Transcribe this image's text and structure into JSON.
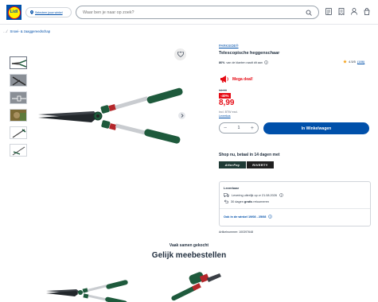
{
  "header": {
    "logo_text": "Lidl",
    "store_selector_label": "Selecteer jouw winkel",
    "search_placeholder": "Waar ben je naar op zoek?",
    "icons": [
      "my-list-icon",
      "receipt-icon",
      "account-icon",
      "cart-icon"
    ]
  },
  "breadcrumb": {
    "separator": "…/",
    "category": "Snoei- & zaaggereedschap"
  },
  "gallery": {
    "thumbnail_count": 6,
    "active_index": 0
  },
  "product": {
    "brand": "PARKSIDE®",
    "title": "Telescopische heggenschaar",
    "recommend_pct": "86%",
    "recommend_text": "van de klanten raadt dit aan",
    "rating": "4.5/5",
    "review_count": "(186)",
    "deal_label": "Mega deal!",
    "old_price": "14.99",
    "discount": "-40%",
    "price": "8,99",
    "vat_text": "Incl. BTW excl.",
    "delivery_cost_link": "Leverkos",
    "quantity": "1",
    "quantity_minus": "−",
    "quantity_plus": "+",
    "cart_button": "In Winkelwagen",
    "paylater_text": "Shop nu, betaal in 14 dagen met",
    "pay_logos": [
      "AfterPay",
      "RIVERTY"
    ],
    "availability": {
      "title": "Leverbaar",
      "delivery_text": "Levering uiterlijk op vr 21.08.2026",
      "returns_text_pre": "30 dagen ",
      "returns_text_bold": "gratis",
      "returns_text_post": " retourneren",
      "store_text": "Ook in de winkel 19/08 - 25/08"
    },
    "article_number": "Artikelnummer: 100397648"
  },
  "recommendations": {
    "subtitle": "Vaak samen gekocht",
    "title": "Gelijk meebestellen"
  },
  "colors": {
    "brand_blue": "#0050aa",
    "deal_red": "#e60a14",
    "tool_green": "#1e5a3c"
  }
}
